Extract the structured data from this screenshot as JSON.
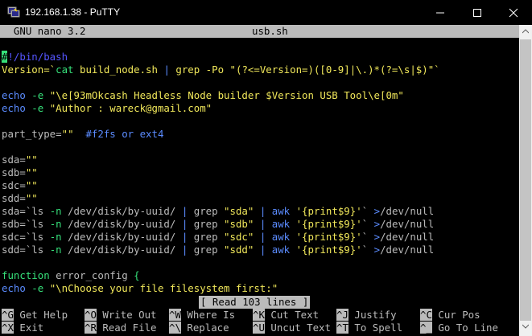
{
  "window": {
    "title": "192.168.1.38 - PuTTY"
  },
  "nano": {
    "version": "  GNU nano 3.2",
    "filename": "usb.sh"
  },
  "editor": {
    "l1": {
      "cursor": "#",
      "rest": "!/bin/bash"
    },
    "l2": {
      "a": "Version=`",
      "b": "cat",
      "c": " build_node.sh ",
      "d": "|",
      "e": " grep ",
      "f": "-Po",
      "g": " \"(?<=Version=)([0-9]|\\.)*(?=\\s|$)\"",
      "h": "`"
    },
    "l4": {
      "a": "echo",
      "b": " -e",
      "c": " \"\\e[93mOkcash Headless Node builder $Version USB Tool\\e[0m\""
    },
    "l5": {
      "a": "echo",
      "b": " -e",
      "c": " \"Author : wareck@gmail.com\""
    },
    "l7": {
      "a": "part_type=",
      "b": "\"\"",
      "c": "  #f2fs or ext4"
    },
    "sda": {
      "a": "sda=",
      "b": "\"\""
    },
    "sdb": {
      "a": "sdb=",
      "b": "\"\""
    },
    "sdc": {
      "a": "sdc=",
      "b": "\"\""
    },
    "sdd": {
      "a": "sdd=",
      "b": "\"\""
    },
    "ls": [
      {
        "a": "sda=`ls ",
        "b": "-n",
        "c": " /dev/disk/by-uuid/ ",
        "d": "|",
        "e": " grep ",
        "f": "\"sda\"",
        "g": " | ",
        "h": "awk",
        "i": " '{print$9}'",
        "j": "` ",
        "k": ">",
        "l": "/dev/null"
      },
      {
        "a": "sdb=`ls ",
        "b": "-n",
        "c": " /dev/disk/by-uuid/ ",
        "d": "|",
        "e": " grep ",
        "f": "\"sdb\"",
        "g": " | ",
        "h": "awk",
        "i": " '{print$9}'",
        "j": "` ",
        "k": ">",
        "l": "/dev/null"
      },
      {
        "a": "sdc=`ls ",
        "b": "-n",
        "c": " /dev/disk/by-uuid/ ",
        "d": "|",
        "e": " grep ",
        "f": "\"sdc\"",
        "g": " | ",
        "h": "awk",
        "i": " '{print$9}'",
        "j": "` ",
        "k": ">",
        "l": "/dev/null"
      },
      {
        "a": "sdd=`ls ",
        "b": "-n",
        "c": " /dev/disk/by-uuid/ ",
        "d": "|",
        "e": " grep ",
        "f": "\"sdd\"",
        "g": " | ",
        "h": "awk",
        "i": " '{print$9}'",
        "j": "` ",
        "k": ">",
        "l": "/dev/null"
      }
    ],
    "fn": {
      "a": "function",
      "b": " error_config ",
      "c": "{"
    },
    "last": {
      "a": "echo",
      "b": " -e",
      "c": " \"\\nChoose your file filesystem first:\""
    }
  },
  "status": "[ Read 103 lines ]",
  "shortcuts": {
    "row1": [
      {
        "key": "^G",
        "label": " Get Help  "
      },
      {
        "key": "^O",
        "label": " Write Out "
      },
      {
        "key": "^W",
        "label": " Where Is  "
      },
      {
        "key": "^K",
        "label": " Cut Text  "
      },
      {
        "key": "^J",
        "label": " Justify   "
      },
      {
        "key": "^C",
        "label": " Cur Pos"
      }
    ],
    "row2": [
      {
        "key": "^X",
        "label": " Exit      "
      },
      {
        "key": "^R",
        "label": " Read File "
      },
      {
        "key": "^\\",
        "label": " Replace   "
      },
      {
        "key": "^U",
        "label": " Uncut Text"
      },
      {
        "key": "^T",
        "label": " To Spell  "
      },
      {
        "key": "^_",
        "label": " Go To Line"
      }
    ]
  },
  "colors": {
    "comment": "#5555ff",
    "string": "#f0e75a",
    "keyword": "#36e07a",
    "operator": "#5b8cff"
  }
}
